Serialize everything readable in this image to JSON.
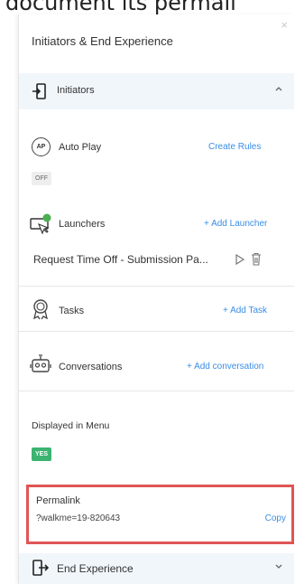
{
  "caption": "document its permali",
  "panel": {
    "title": "Initiators & End Experience",
    "close_glyph": "×"
  },
  "initiators": {
    "header": "Initiators",
    "autoplay": {
      "icon_text": "AP",
      "label": "Auto Play",
      "link": "Create Rules",
      "status": "OFF"
    },
    "launchers": {
      "label": "Launchers",
      "link": "+ Add Launcher",
      "item": "Request Time Off - Submission Pa..."
    },
    "tasks": {
      "label": "Tasks",
      "link": "+ Add Task"
    },
    "conversations": {
      "label": "Conversations",
      "link": "+ Add conversation"
    },
    "menu": {
      "label": "Displayed in Menu",
      "status": "YES"
    },
    "permalink": {
      "label": "Permalink",
      "value": "?walkme=19-820643",
      "copy": "Copy"
    }
  },
  "end_experience": {
    "header": "End Experience"
  },
  "colors": {
    "accent": "#3a8ee6",
    "highlight_border": "#e05555",
    "yes_badge": "#3cb371",
    "header_bg": "#f1f6fb"
  }
}
